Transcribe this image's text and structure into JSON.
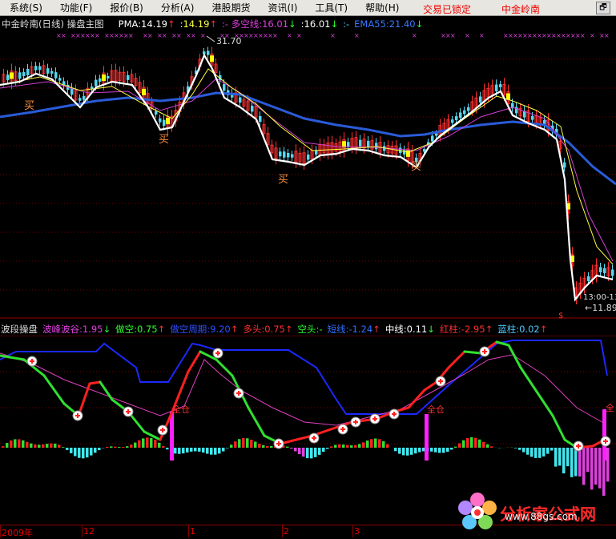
{
  "menu": [
    {
      "label": "系统(S)"
    },
    {
      "label": "功能(F)"
    },
    {
      "label": "报价(B)"
    },
    {
      "label": "分析(A)"
    },
    {
      "label": "港股期货"
    },
    {
      "label": "资讯(I)"
    },
    {
      "label": "工具(T)"
    },
    {
      "label": "帮助(H)"
    }
  ],
  "status": {
    "lock": "交易已锁定",
    "stock": "中金岭南",
    "restore": "🗗"
  },
  "main_header": {
    "title": "中金岭南(日线) 操盘主图",
    "pma": "PMA:14.19",
    "pma_arrow": "↑",
    "v2": ":14.19",
    "v2_arrow": "↑",
    "duokong": ":- 多空线:16.01",
    "duokong_arrow": "↓",
    "v4": ":16.01",
    "v4_arrow": "↓",
    "v5": ":-",
    "ema": "EMA55:21.40",
    "ema_arrow": "↓"
  },
  "sub_header": {
    "title": "波段操盘",
    "bofeng": "波峰波谷:1.95",
    "bofeng_arrow": "↓",
    "zuokong": "做空:0.75",
    "zuokong_arrow": "↑",
    "zuokong_zq": "做空周期:9.20",
    "zuokong_zq_arrow": "↑",
    "duotou": "多头:0.75",
    "duotou_arrow": "↑",
    "kongtou": "空头:-",
    "duanxian": "短线:-1.24",
    "duanxian_arrow": "↑",
    "zhongxian": "中线:0.11",
    "zhongxian_arrow": "↓",
    "hongzhu": "红柱:-2.95",
    "hongzhu_arrow": "↑",
    "lanzhu": "蓝柱:0.02",
    "lanzhu_arrow": "↑"
  },
  "annotations": {
    "high": "31.70",
    "low": "←11.89",
    "time": "13:00-13",
    "buy": "买",
    "full": "全仓",
    "full_short": "全",
    "dollar": "$"
  },
  "time_axis": [
    "2009年",
    "12",
    "1",
    "2",
    "3"
  ],
  "watermark": {
    "title": "分析家公式网",
    "url": "www.88gs.com"
  },
  "colors": {
    "up": "#ff3030",
    "down": "#54d8f0",
    "ema": "#2a5bd8",
    "pma": "#ffffff",
    "ma2": "#ffff40",
    "ma3": "#d040d0",
    "green": "#30e030",
    "red": "#ff2020",
    "blue": "#1c28ff",
    "magenta": "#e040c0"
  }
}
